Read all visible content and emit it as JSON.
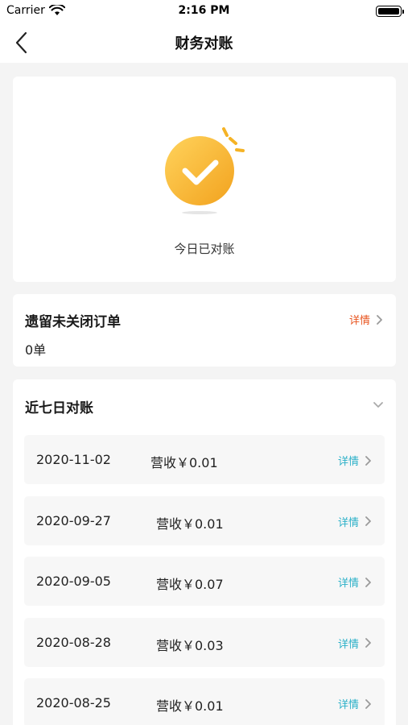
{
  "status_bar": {
    "carrier": "Carrier",
    "time": "2:16 PM"
  },
  "nav": {
    "title": "财务对账",
    "back_icon": "chevron-left-icon"
  },
  "success": {
    "caption": "今日已对账",
    "colors": {
      "accent": "#f5a623",
      "accent_light": "#ffcf55"
    }
  },
  "pending": {
    "title": "遗留未关闭订单",
    "count": "0单",
    "detail_label": "详情",
    "detail_color": "#e8541f"
  },
  "recent": {
    "title": "近七日对账",
    "detail_color": "#2ab0c8",
    "rows": [
      {
        "date": "2020-11-02",
        "revenue": "营收￥0.01",
        "detail": "详情"
      },
      {
        "date": "2020-09-27",
        "revenue": "营收￥0.01",
        "detail": "详情"
      },
      {
        "date": "2020-09-05",
        "revenue": "营收￥0.07",
        "detail": "详情"
      },
      {
        "date": "2020-08-28",
        "revenue": "营收￥0.03",
        "detail": "详情"
      },
      {
        "date": "2020-08-25",
        "revenue": "营收￥0.01",
        "detail": "详情"
      }
    ]
  }
}
